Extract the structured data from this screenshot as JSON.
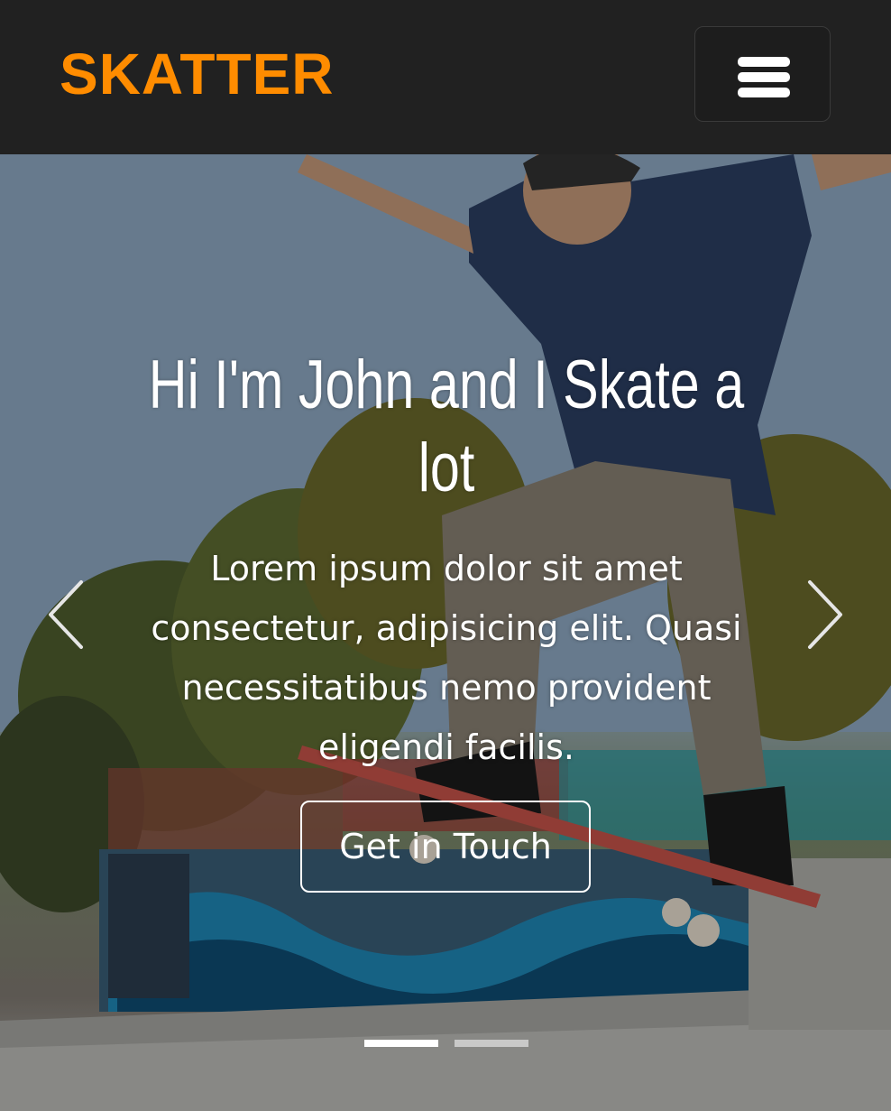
{
  "navbar": {
    "brand": "SKATTER",
    "brand_color": "#ff8c00",
    "toggler_icon": "hamburger-menu-icon"
  },
  "hero": {
    "heading": "Hi I'm John and I Skate a lot",
    "text": "Lorem ipsum dolor sit amet consectetur, adipisicing elit. Quasi necessitatibus nemo provident eligendi facilis.",
    "cta_label": "Get in Touch",
    "prev_icon": "chevron-left-icon",
    "next_icon": "chevron-right-icon",
    "slide_count": 2,
    "active_slide": 1
  }
}
